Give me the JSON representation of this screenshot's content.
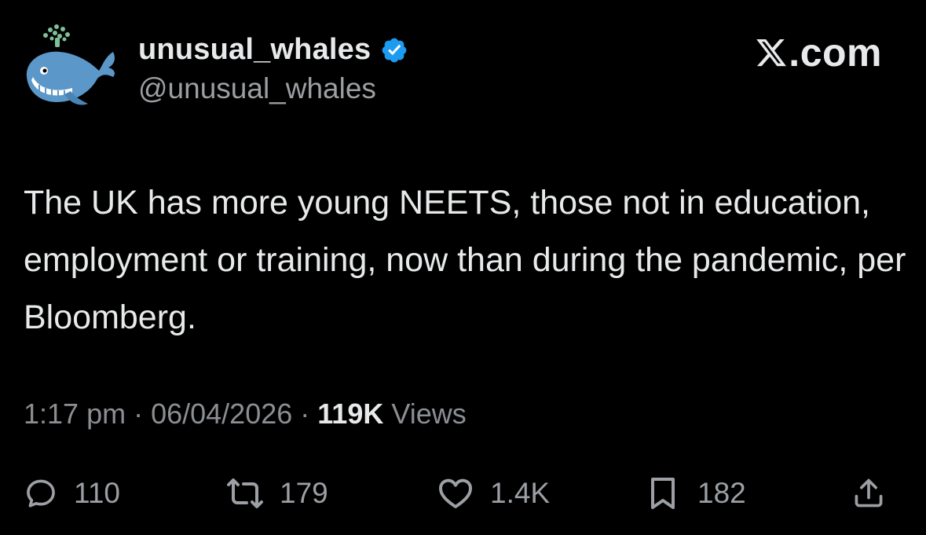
{
  "author": {
    "display_name": "unusual_whales",
    "handle": "@unusual_whales",
    "verified": true,
    "avatar_icon": "whale-icon"
  },
  "brand": {
    "text": ".com",
    "icon": "x-logo-icon"
  },
  "tweet": {
    "text": "The UK has more young NEETS, those not in education, employment or training, now than during the pandemic, per Bloomberg."
  },
  "meta": {
    "time": "1:17 pm",
    "sep1": " · ",
    "date": "06/04/2026",
    "sep2": " · ",
    "views_count": "119K",
    "views_label": " Views"
  },
  "actions": {
    "reply": {
      "icon": "reply-icon",
      "count": "110"
    },
    "retweet": {
      "icon": "retweet-icon",
      "count": "179"
    },
    "like": {
      "icon": "heart-icon",
      "count": "1.4K"
    },
    "bookmark": {
      "icon": "bookmark-icon",
      "count": "182"
    },
    "share": {
      "icon": "share-icon"
    }
  },
  "colors": {
    "background": "#000000",
    "text": "#e7e9ea",
    "secondary": "#9c9fa3",
    "verified": "#1d9bf0",
    "whale_body": "#5b97c8",
    "whale_spout": "#7fbf9a"
  }
}
